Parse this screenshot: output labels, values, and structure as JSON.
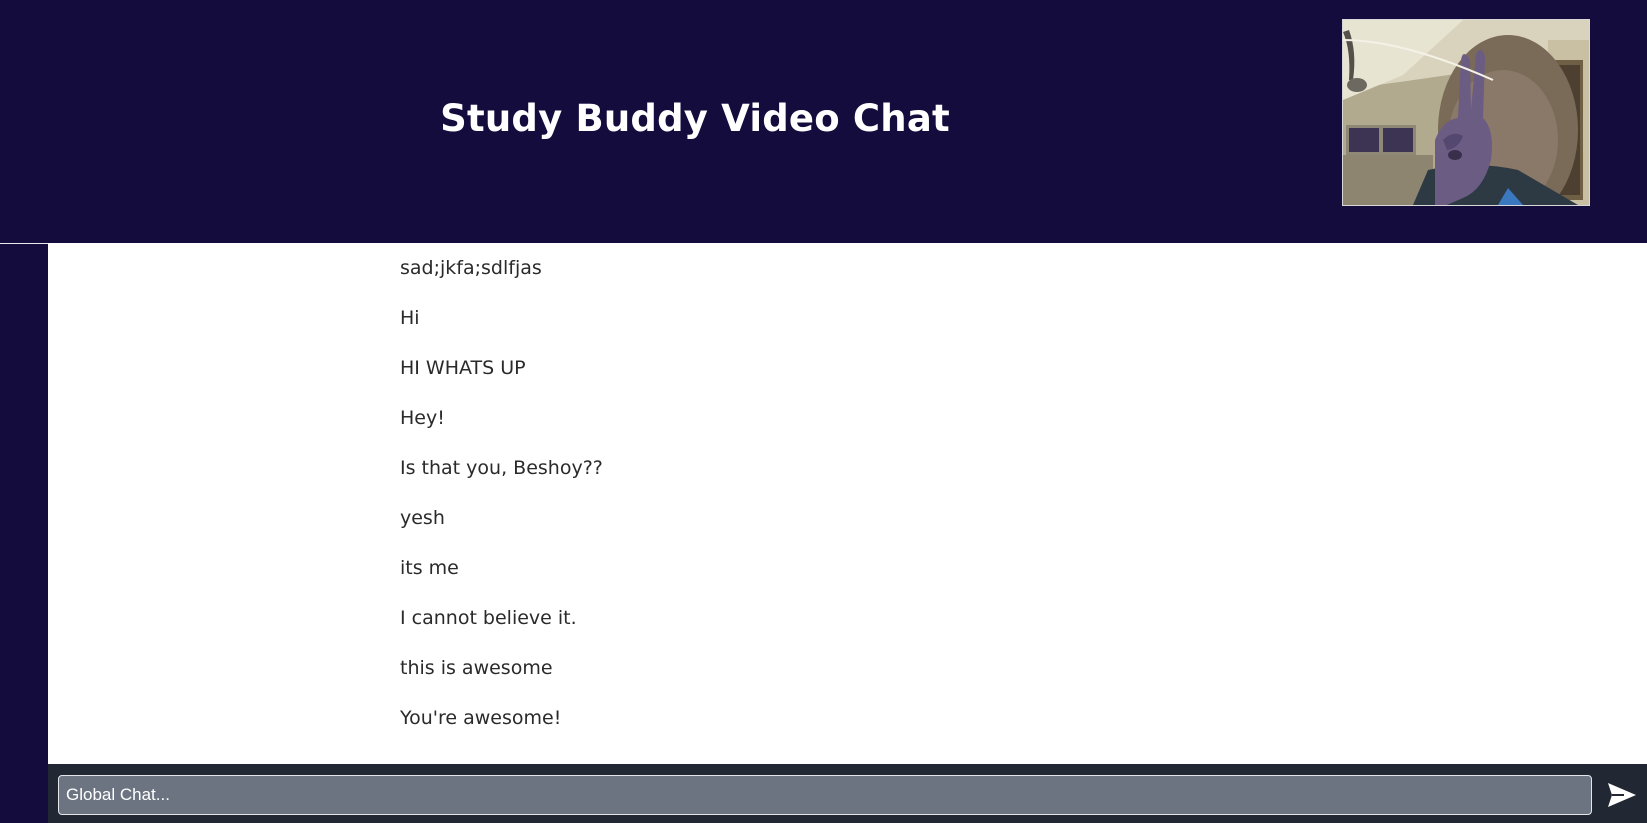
{
  "header": {
    "title": "Study Buddy Video Chat"
  },
  "chat": {
    "messages": [
      "sad;jkfa;sdlfjas",
      "Hi",
      "HI WHATS UP",
      "Hey!",
      "Is that you, Beshoy??",
      "yesh",
      "its me",
      "I cannot believe it.",
      "this is awesome",
      "You're awesome!"
    ]
  },
  "input": {
    "placeholder": "Global Chat...",
    "value": ""
  },
  "icons": {
    "send": "send-arrow-icon"
  },
  "colors": {
    "header_bg": "#130c3d",
    "chat_bg": "#ffffff",
    "input_bar_bg": "#212833",
    "input_bg": "#6c7482",
    "title_text": "#ffffff",
    "message_text": "#2a2a2a"
  }
}
